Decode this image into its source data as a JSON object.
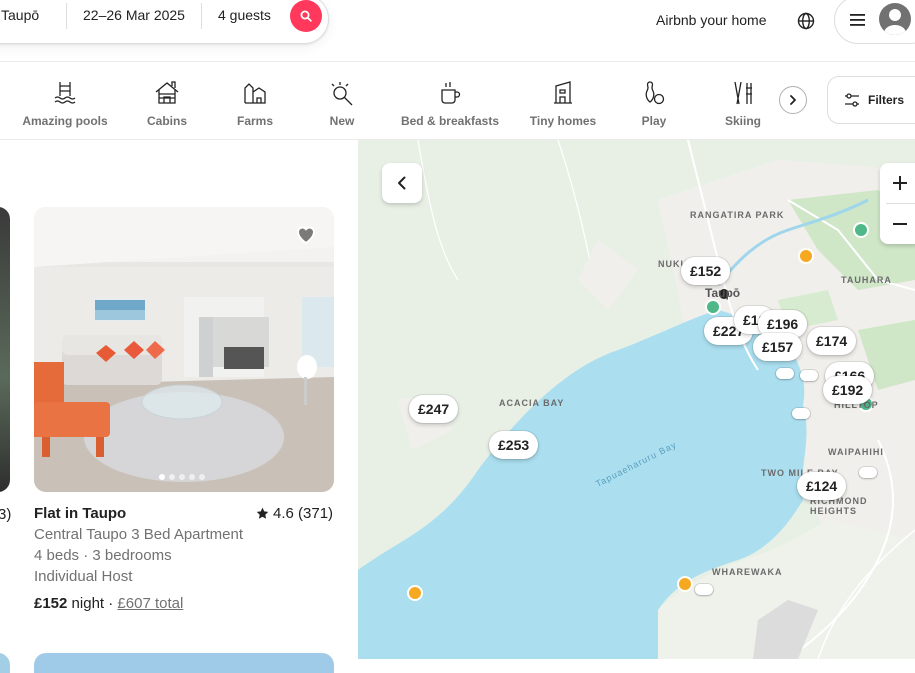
{
  "search": {
    "location": "Taupō",
    "dates": "22–26 Mar 2025",
    "guests": "4 guests"
  },
  "header": {
    "host_link": "Airbnb your home"
  },
  "categories": [
    {
      "label": "Amazing pools",
      "icon": "pool-icon"
    },
    {
      "label": "Cabins",
      "icon": "cabin-icon"
    },
    {
      "label": "Farms",
      "icon": "farm-icon"
    },
    {
      "label": "New",
      "icon": "new-icon"
    },
    {
      "label": "Bed & breakfasts",
      "icon": "bed-breakfast-icon"
    },
    {
      "label": "Tiny homes",
      "icon": "tiny-home-icon"
    },
    {
      "label": "Play",
      "icon": "play-icon"
    },
    {
      "label": "Skiing",
      "icon": "skiing-icon"
    }
  ],
  "filters": {
    "label": "Filters"
  },
  "left_listing": {
    "rating_fragment": "3)"
  },
  "listing": {
    "title": "Flat in Taupo",
    "rating": "4.6 (371)",
    "subtitle": "Central Taupo 3 Bed Apartment",
    "details": "4 beds · 3 bedrooms",
    "host": "Individual Host",
    "price": "£152",
    "price_unit": "night ·",
    "total": "£607 total",
    "photo_count": 5,
    "active_photo": 1
  },
  "map": {
    "places": [
      "RANGATIRA PARK",
      "NUKU",
      "Taupō",
      "TAUHARA",
      "ACACIA BAY",
      "HILLTOP",
      "WAIPAHIHI",
      "TWO MILE BAY",
      "RICHMOND",
      "HEIGHTS",
      "WHAREWAKA",
      "Tapuaeharuru Bay"
    ],
    "pins": [
      "£152",
      "£227",
      "£18",
      "£196",
      "£157",
      "£174",
      "£166",
      "£192",
      "£247",
      "£253",
      "£124"
    ],
    "colors": {
      "water": "#abdff0",
      "land": "#e8f0e6",
      "park": "#c8e6c0",
      "accent": "#ff385c"
    }
  }
}
